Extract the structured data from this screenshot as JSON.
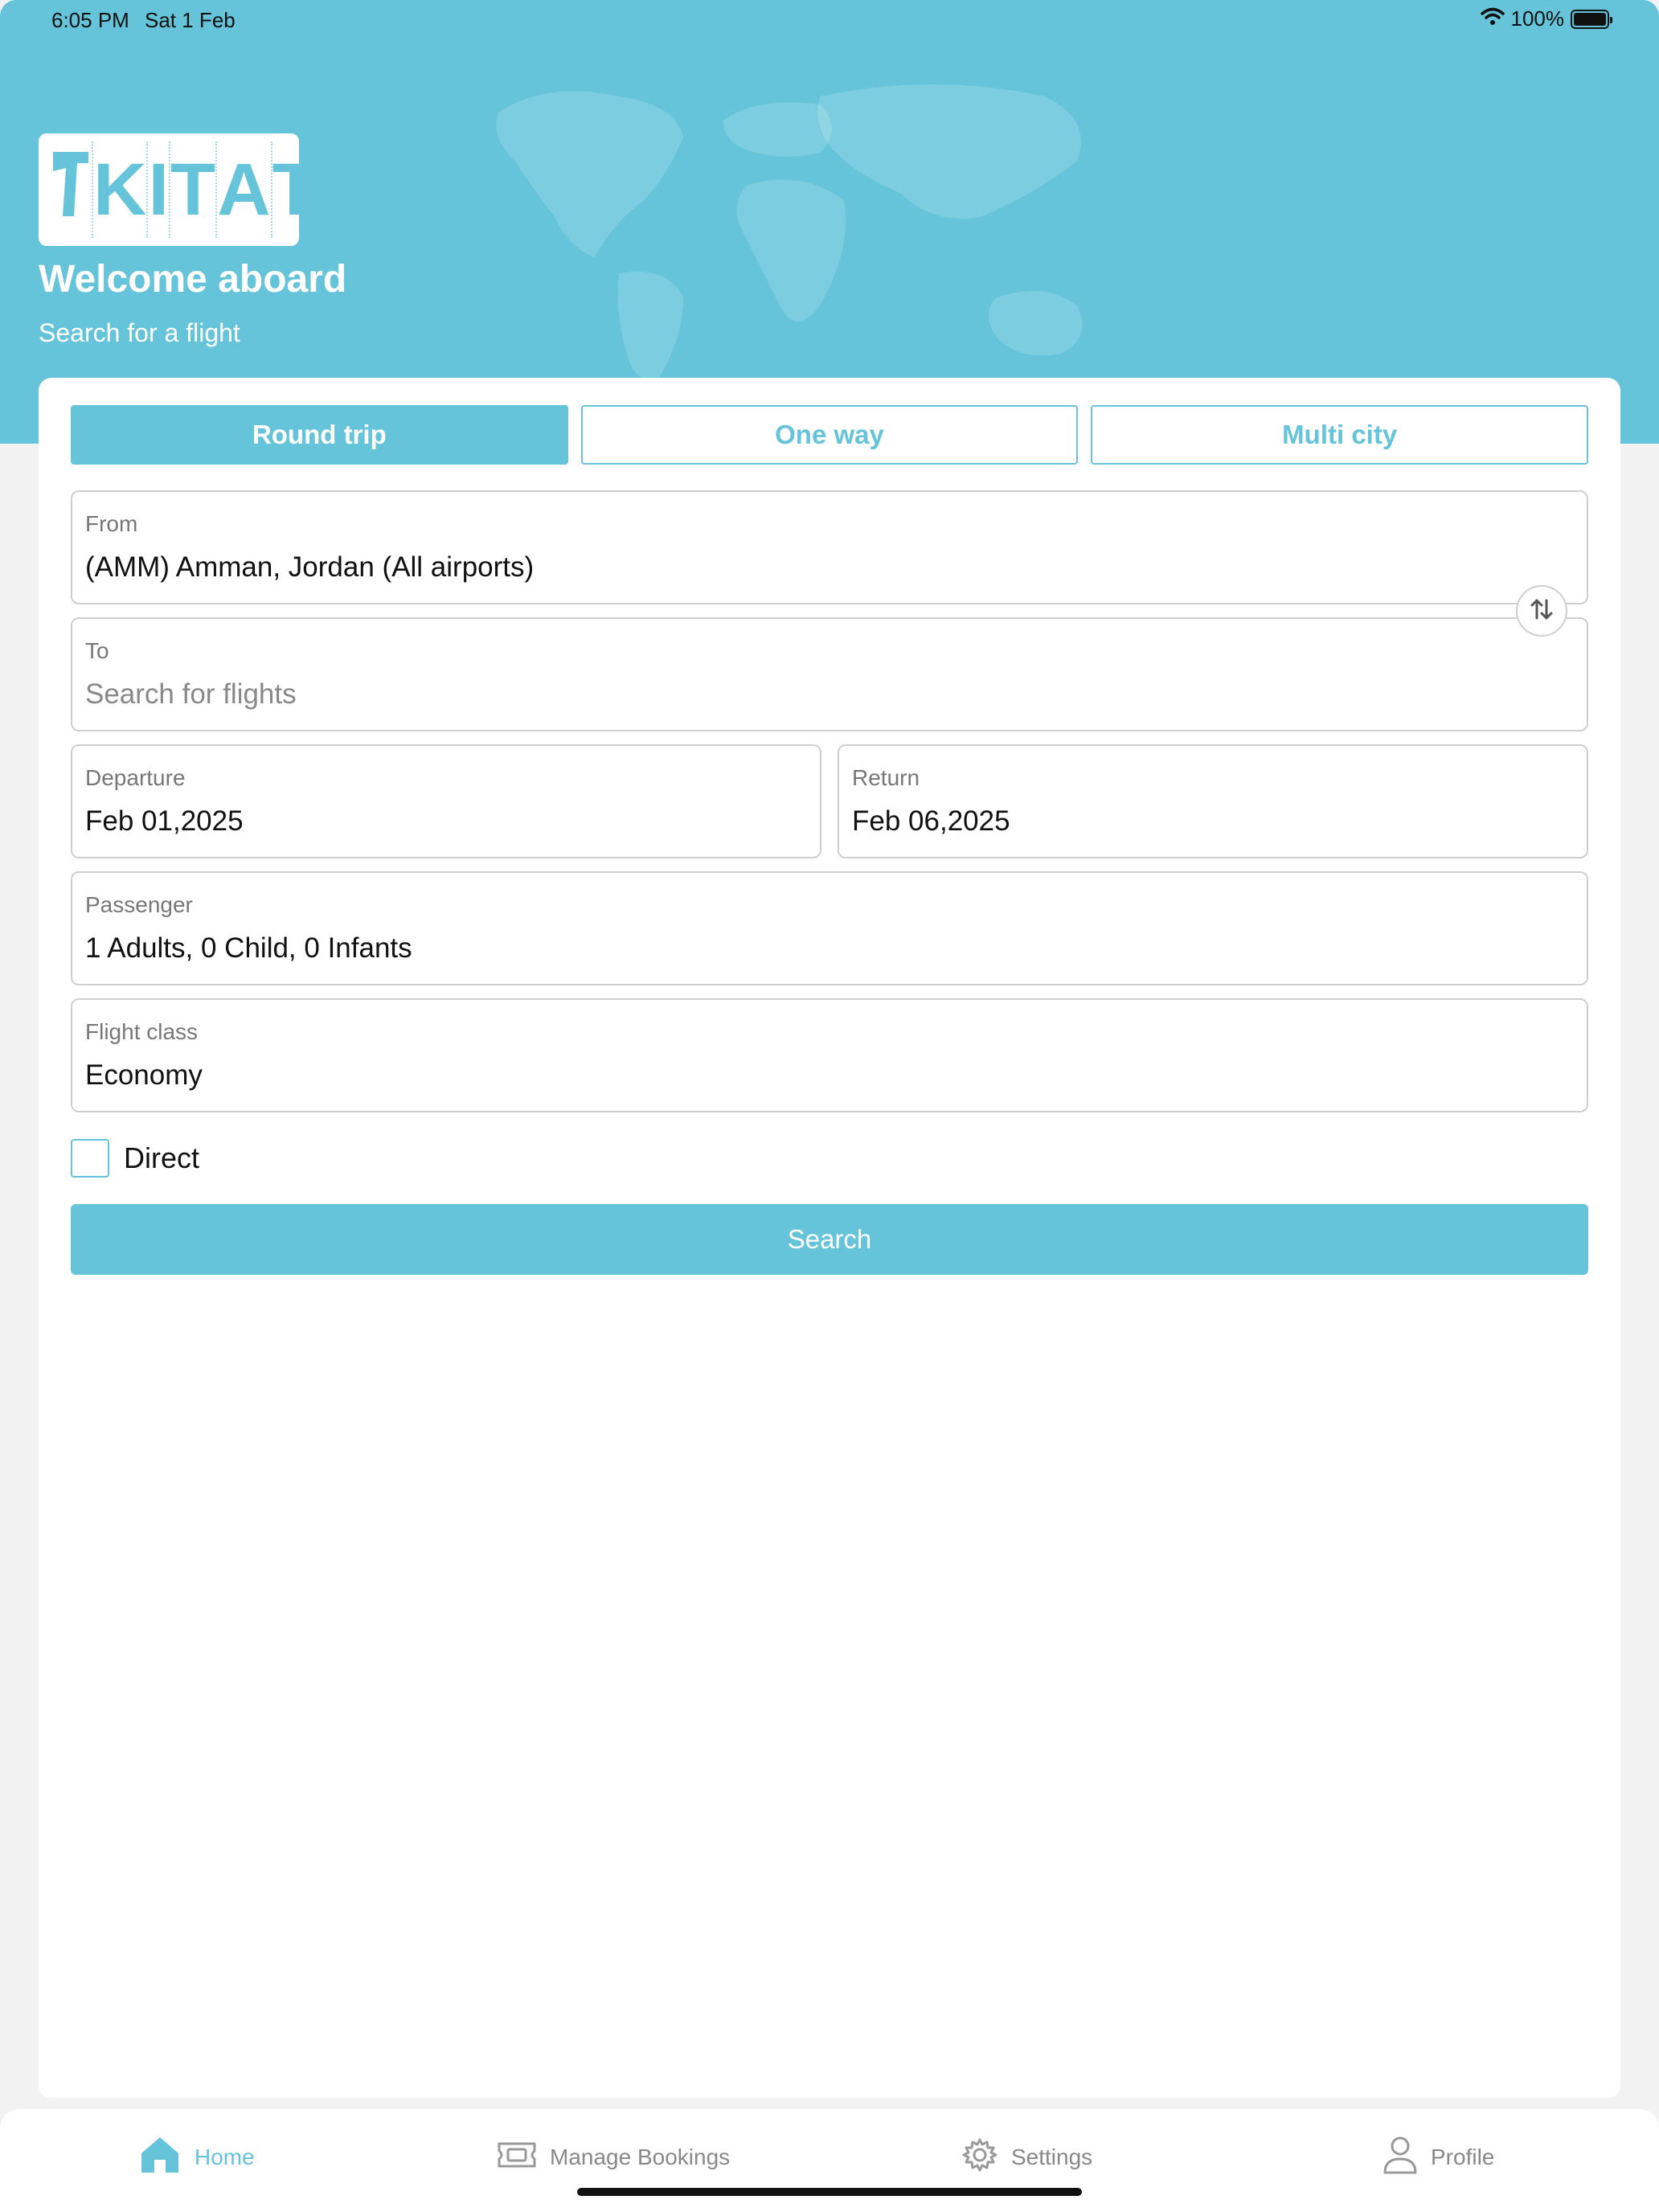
{
  "status_bar": {
    "time": "6:05 PM",
    "date": "Sat 1 Feb",
    "battery": "100%",
    "battery_level": 1.0
  },
  "header": {
    "logo_text": "TKITAT",
    "welcome": "Welcome aboard",
    "subtitle": "Search for a flight"
  },
  "trip_tabs": [
    {
      "label": "Round trip",
      "active": true
    },
    {
      "label": "One way",
      "active": false
    },
    {
      "label": "Multi city",
      "active": false
    }
  ],
  "form": {
    "from": {
      "label": "From",
      "value": "(AMM) Amman, Jordan (All airports)"
    },
    "to": {
      "label": "To",
      "placeholder": "Search for flights"
    },
    "departure": {
      "label": "Departure",
      "value": "Feb 01,2025"
    },
    "return": {
      "label": "Return",
      "value": "Feb 06,2025"
    },
    "passenger": {
      "label": "Passenger",
      "value": "1 Adults, 0 Child, 0 Infants"
    },
    "flight_class": {
      "label": "Flight class",
      "value": "Economy"
    },
    "direct": {
      "label": "Direct",
      "checked": false
    },
    "search_label": "Search"
  },
  "tabbar": [
    {
      "label": "Home",
      "icon": "home-icon",
      "active": true
    },
    {
      "label": "Manage Bookings",
      "icon": "ticket-icon",
      "active": false
    },
    {
      "label": "Settings",
      "icon": "gear-icon",
      "active": false
    },
    {
      "label": "Profile",
      "icon": "user-icon",
      "active": false
    }
  ],
  "colors": {
    "accent": "#65c4da",
    "background": "#f2f2f2",
    "border": "#cfcfcf"
  }
}
